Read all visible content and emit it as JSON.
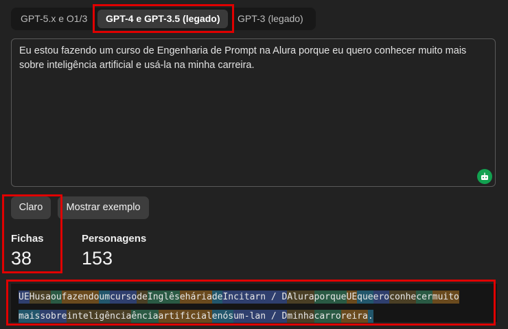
{
  "tabs": [
    {
      "label": "GPT-5.x e O1/3"
    },
    {
      "label": "GPT-4 e GPT-3.5 (legado)"
    },
    {
      "label": "GPT-3 (legado)"
    }
  ],
  "input": {
    "text": "Eu estou fazendo um curso de Engenharia de Prompt na Alura porque eu quero conhecer muito mais sobre inteligência artificial e usá-la na minha carreira."
  },
  "buttons": {
    "clear_label": "Claro",
    "example_label": "Mostrar exemplo"
  },
  "stats": {
    "tokens_label": "Fichas",
    "tokens_value": "38",
    "characters_label": "Personagens",
    "characters_value": "153"
  },
  "icon_names": [
    "bot-icon"
  ],
  "colors": {
    "highlight": "#e00000",
    "token_palette": [
      "#2f3f6e",
      "#4a3f25",
      "#2a5a44",
      "#6a4a1e",
      "#22576c"
    ]
  },
  "token_lines": [
    [
      "UE",
      "Husa",
      "ou",
      "fazendo",
      "um",
      "curso",
      "de",
      "Inglês",
      "ehária",
      "de",
      "Incitarn / D",
      "Alura",
      "porque",
      "UE",
      "que",
      "ero",
      "conhe",
      "cer",
      "muito"
    ],
    [
      "mais",
      "sobre",
      "inteligência",
      "ência",
      "artificial",
      "enós",
      "um-lan / D",
      "minha",
      "carro",
      "reira",
      "."
    ]
  ]
}
